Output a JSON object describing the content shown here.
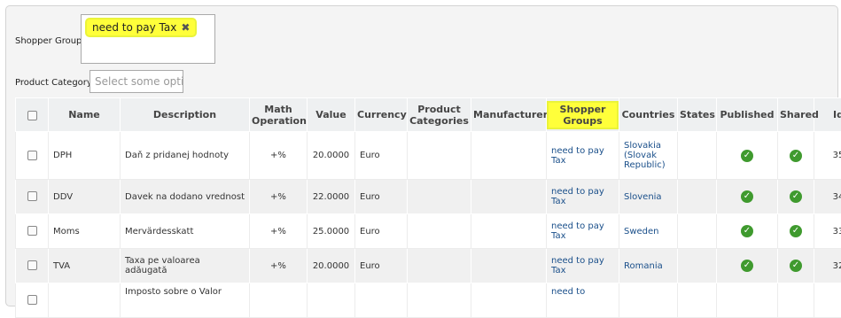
{
  "filters": {
    "shopper_group_label": "Shopper Group",
    "shopper_group_tag": "need to pay Tax",
    "tag_remove_glyph": "✖",
    "product_category_label": "Product Category",
    "product_category_placeholder": "Select some opti"
  },
  "table": {
    "headers": {
      "name": "Name",
      "description": "Description",
      "math_operation": "Math Operation",
      "value": "Value",
      "currency": "Currency",
      "product_categories": "Product Categories",
      "manufacturer": "Manufacturer",
      "shopper_groups": "Shopper Groups",
      "countries": "Countries",
      "states": "States",
      "published": "Published",
      "shared": "Shared",
      "id": "Id"
    },
    "rows": [
      {
        "name": "DPH",
        "description": "Daň z pridanej hodnoty",
        "math": "+%",
        "value": "20.0000",
        "currency": "Euro",
        "shopper_group": "need to pay Tax",
        "country": "Slovakia (Slovak Republic)",
        "id": "35"
      },
      {
        "name": "DDV",
        "description": "Davek na dodano vrednost",
        "math": "+%",
        "value": "22.0000",
        "currency": "Euro",
        "shopper_group": "need to pay Tax",
        "country": "Slovenia",
        "id": "34"
      },
      {
        "name": "Moms",
        "description": "Mervärdesskatt",
        "math": "+%",
        "value": "25.0000",
        "currency": "Euro",
        "shopper_group": "need to pay Tax",
        "country": "Sweden",
        "id": "33"
      },
      {
        "name": "TVA",
        "description": "Taxa pe valoarea adăugată",
        "math": "+%",
        "value": "20.0000",
        "currency": "Euro",
        "shopper_group": "need to pay Tax",
        "country": "Romania",
        "id": "32"
      },
      {
        "name": "",
        "description": "Imposto sobre o Valor",
        "math": "",
        "value": "",
        "currency": "",
        "shopper_group": "need to",
        "country": "",
        "id": ""
      }
    ]
  },
  "colors": {
    "highlight": "#ffff3a",
    "link": "#1a4f8a",
    "check_icon": "#3f9a2e"
  },
  "icons": {
    "published": "check-circle-icon",
    "shared": "check-circle-icon"
  }
}
